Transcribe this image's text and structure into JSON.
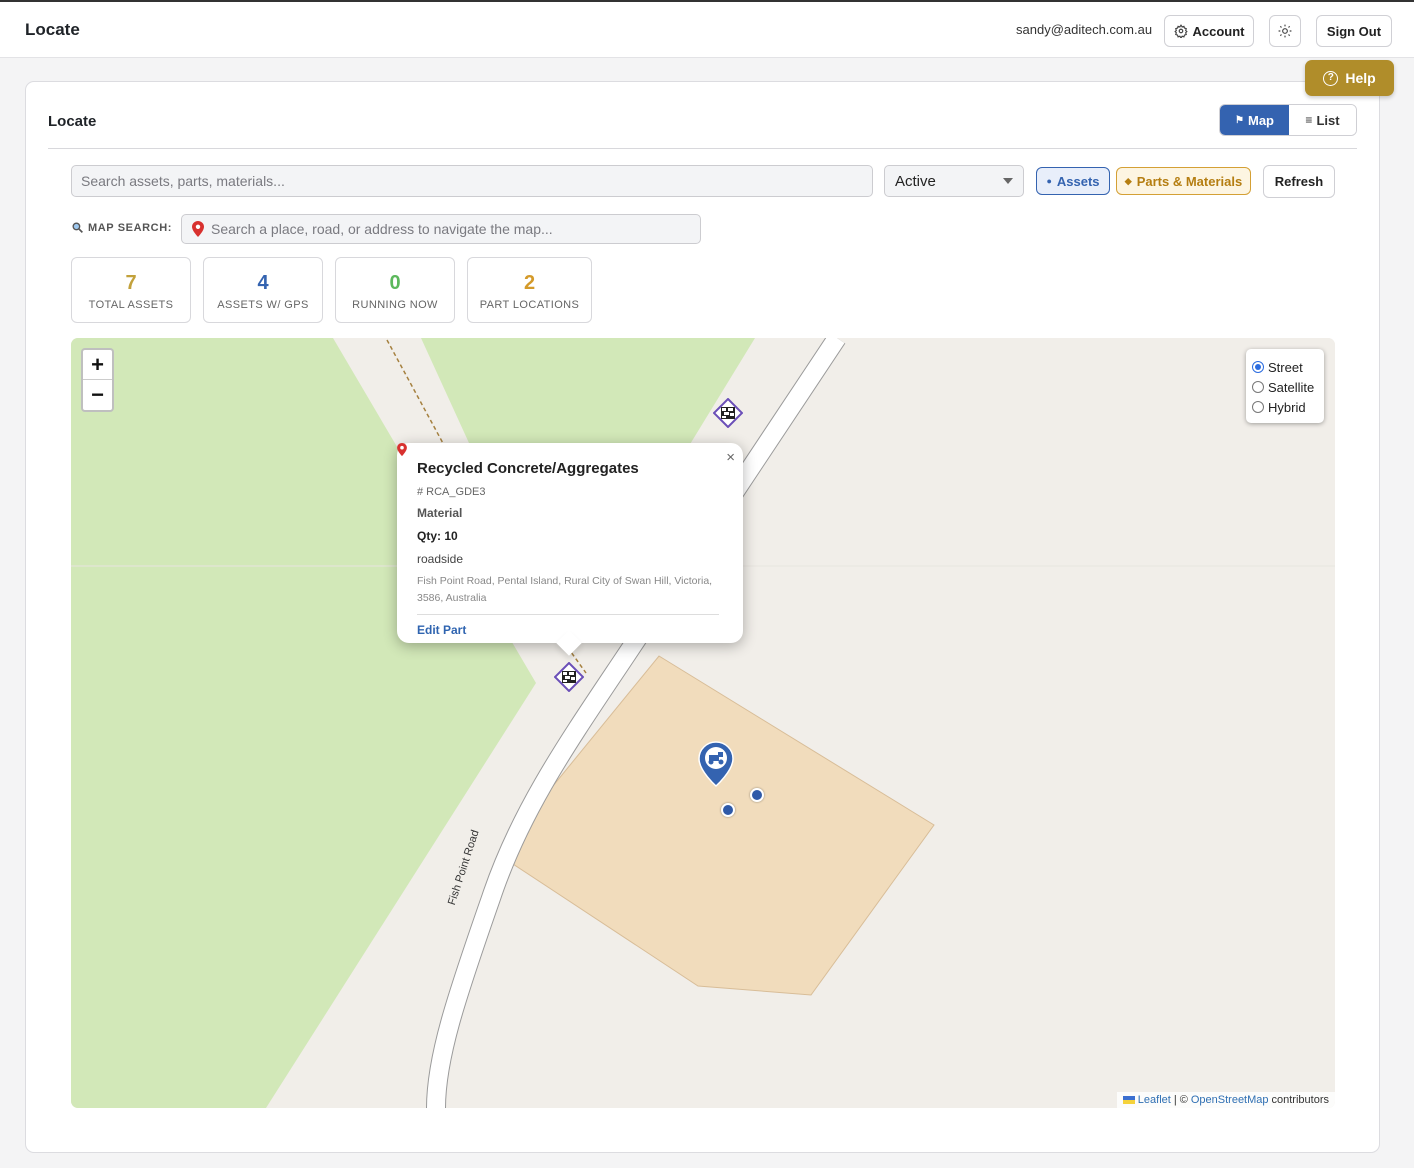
{
  "header": {
    "brand": "Locate",
    "user_email": "sandy@aditech.com.au",
    "account_label": "Account",
    "signout_label": "Sign Out",
    "help_label": "Help"
  },
  "page": {
    "title": "Locate",
    "view_map_label": "Map",
    "view_list_label": "List",
    "active_view": "Map"
  },
  "filters": {
    "search_placeholder": "Search assets, parts, materials...",
    "status_value": "Active",
    "chip_assets_label": "Assets",
    "chip_parts_label": "Parts & Materials",
    "refresh_label": "Refresh"
  },
  "map_search": {
    "label": "MAP SEARCH:",
    "placeholder": "Search a place, road, or address to navigate the map..."
  },
  "stats": [
    {
      "value": "7",
      "label": "TOTAL ASSETS",
      "color": "#c2a13b"
    },
    {
      "value": "4",
      "label": "ASSETS W/ GPS",
      "color": "#3463b0"
    },
    {
      "value": "0",
      "label": "RUNNING NOW",
      "color": "#5cb85c"
    },
    {
      "value": "2",
      "label": "PART LOCATIONS",
      "color": "#d49a2a"
    }
  ],
  "map": {
    "zoom_in": "+",
    "zoom_out": "−",
    "layers": [
      {
        "label": "Street",
        "selected": true
      },
      {
        "label": "Satellite",
        "selected": false
      },
      {
        "label": "Hybrid",
        "selected": false
      }
    ],
    "road_label": "Fish Point Road",
    "attribution_leaflet": "Leaflet",
    "attribution_sep": "| ©",
    "attribution_osm": "OpenStreetMap",
    "attribution_tail": "contributors"
  },
  "popup": {
    "title": "Recycled Concrete/Aggregates",
    "code": "# RCA_GDE3",
    "type": "Material",
    "qty": "Qty: 10",
    "location_name": "roadside",
    "address": "Fish Point Road, Pental Island, Rural City of Swan Hill, Victoria, 3586, Australia",
    "edit_label": "Edit Part",
    "close": "×"
  },
  "colors": {
    "primary": "#3463b0",
    "help": "#b08d2a",
    "parts": "#d49a2a"
  }
}
